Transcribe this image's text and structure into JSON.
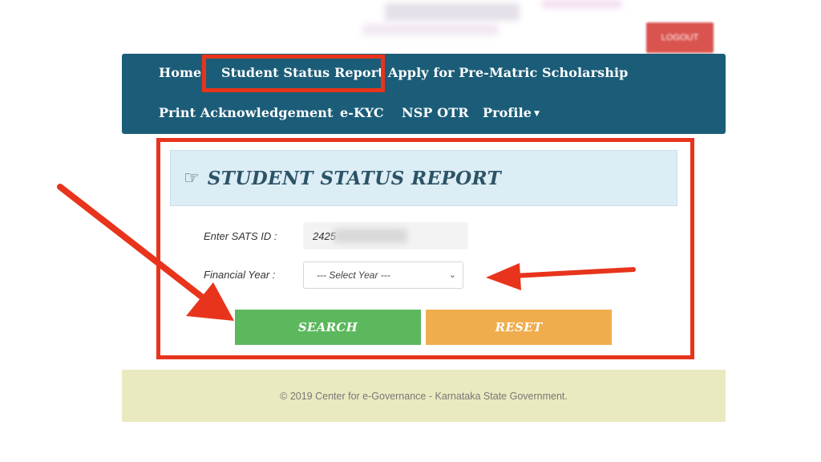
{
  "header": {
    "logout_label": "LOGOUT"
  },
  "nav": {
    "items": [
      {
        "label": "Home"
      },
      {
        "label": "Student Status Report"
      },
      {
        "label": "Apply for Pre-Matric Scholarship"
      },
      {
        "label": "Print Acknowledgement"
      },
      {
        "label": "e-KYC"
      },
      {
        "label": "NSP OTR"
      },
      {
        "label": "Profile"
      }
    ]
  },
  "panel": {
    "title": "STUDENT STATUS REPORT",
    "sats_label": "Enter SATS ID :",
    "sats_value": "2425",
    "year_label": "Financial Year :",
    "year_selected": "--- Select Year ---",
    "search_label": "SEARCH",
    "reset_label": "RESET"
  },
  "footer": {
    "text": "© 2019 Center for e-Governance - Karnataka State Government."
  },
  "colors": {
    "nav_bg": "#1b5d78",
    "annotation": "#e8341c",
    "search": "#5cb85c",
    "reset": "#f0ad4e",
    "footer_bg": "#eaeac0"
  }
}
